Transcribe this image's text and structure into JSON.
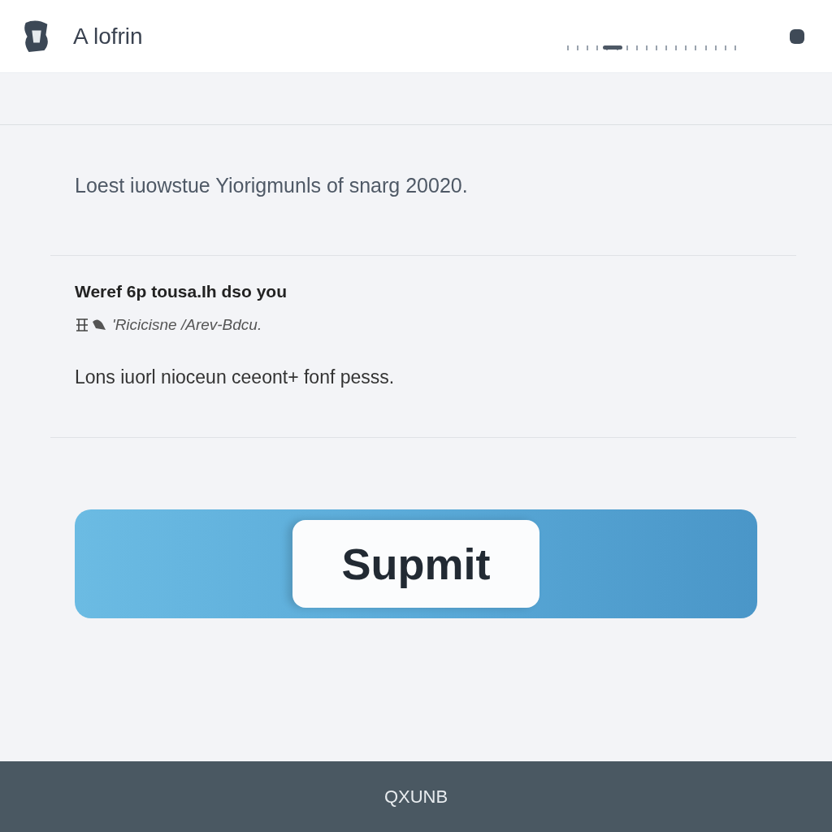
{
  "header": {
    "title": "A lofrin",
    "slider": {
      "level": 0.27
    }
  },
  "intro": "Loest iuowstue Yiorigmunls of snarg 20020.",
  "section": {
    "heading": "Weref 6p tousa.Ih dso you",
    "note": "'Ricicisne /Arev-Bdcu.",
    "body": "Lons iuorl nioceun ceeont+ fonf pesss."
  },
  "submit": {
    "label": "Supmit"
  },
  "footer": {
    "text": "QXUNB"
  }
}
